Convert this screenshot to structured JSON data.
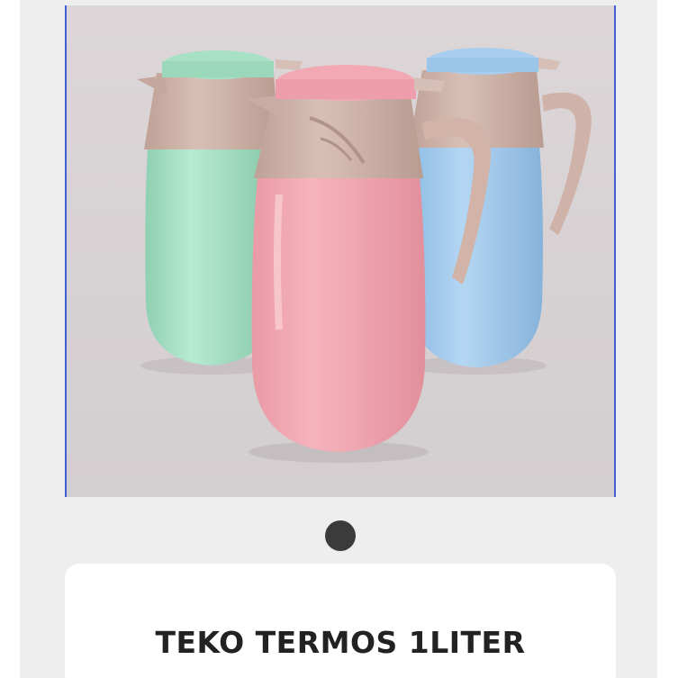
{
  "product": {
    "title": "TEKO TERMOS 1LITER",
    "image_subject": "three-pastel-thermos-jugs"
  },
  "carousel": {
    "active_index": 1,
    "dot_count": 1
  },
  "colors": {
    "panel_background": "#eeeeee",
    "card_background": "#ffffff",
    "dot": "#3b3b3b",
    "image_border": "#3f5fd6",
    "green_jug": "#9fdcc0",
    "pink_jug": "#f2a3ad",
    "blue_jug": "#9cc7ea",
    "jug_collar": "#c9aea4"
  }
}
